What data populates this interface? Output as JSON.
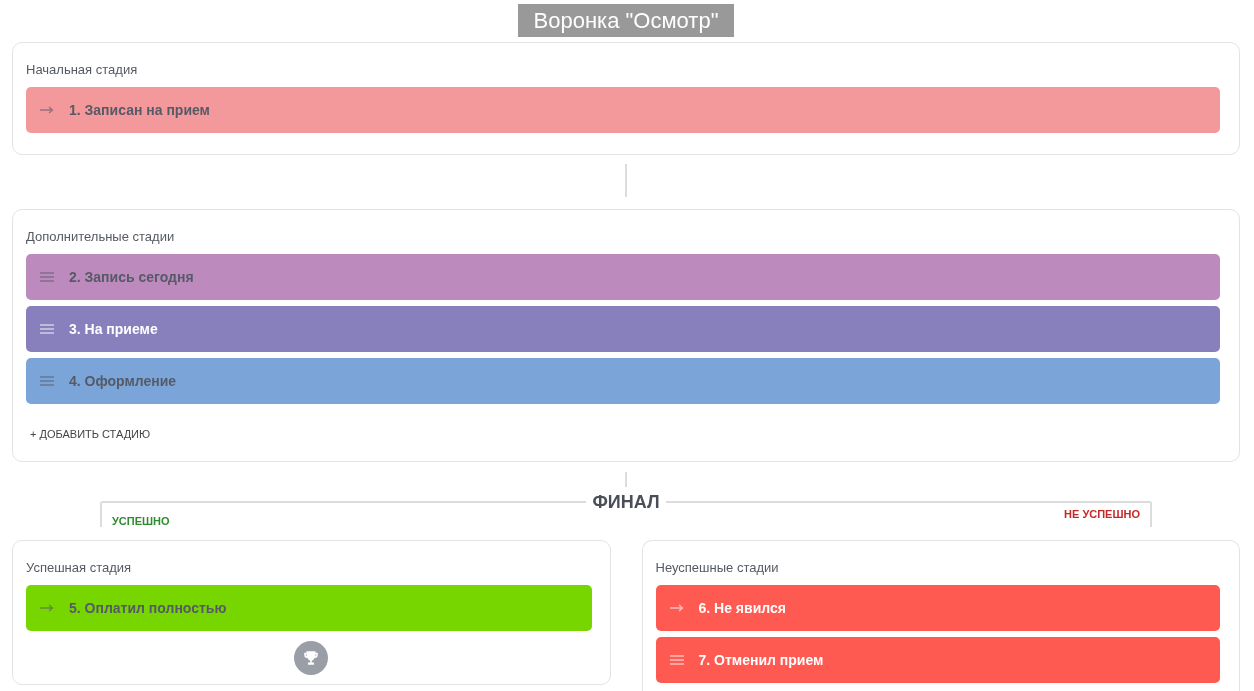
{
  "title": "Воронка \"Осмотр\"",
  "initial": {
    "label": "Начальная стадия",
    "stages": [
      {
        "name": "1. Записан на прием",
        "kind": "arrow",
        "color": "#f4999b",
        "light_text": false
      }
    ]
  },
  "additional": {
    "label": "Дополнительные стадии",
    "stages": [
      {
        "name": "2. Запись сегодня",
        "kind": "drag",
        "color": "#bd8abe",
        "light_text": false
      },
      {
        "name": "3. На приеме",
        "kind": "drag",
        "color": "#8880bc",
        "light_text": true
      },
      {
        "name": "4. Оформление",
        "kind": "drag",
        "color": "#7ba5d8",
        "light_text": false
      }
    ],
    "add_button": "+ ДОБАВИТЬ СТАДИЮ"
  },
  "final": {
    "title": "ФИНАЛ",
    "success_label": "УСПЕШНО",
    "fail_label": "НЕ УСПЕШНО"
  },
  "success": {
    "label": "Успешная стадия",
    "stages": [
      {
        "name": "5. Оплатил полностью",
        "kind": "arrow",
        "color": "#78d600",
        "light_text": false
      }
    ]
  },
  "failure": {
    "label": "Неуспешные стадии",
    "stages": [
      {
        "name": "6. Не явился",
        "kind": "arrow",
        "color": "#ff5a52",
        "light_text": true
      },
      {
        "name": "7. Отменил прием",
        "kind": "drag",
        "color": "#ff5a52",
        "light_text": true
      }
    ]
  }
}
